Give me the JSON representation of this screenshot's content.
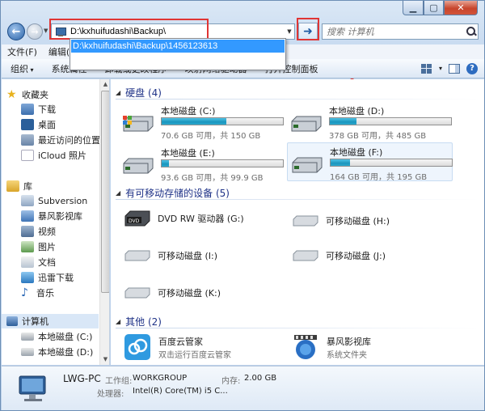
{
  "address": {
    "value": "D:\\kxhuifudashi\\Backup\\",
    "suggestion": "D:\\kxhuifudashi\\Backup\\1456123613"
  },
  "search": {
    "placeholder": "搜索 计算机"
  },
  "menu": {
    "file": "文件(F)",
    "edit": "编辑(E)"
  },
  "toolbar": {
    "organize": "组织",
    "system_properties": "系统属性",
    "uninstall": "卸载或更改程序",
    "map_drive": "映射网络驱动器",
    "control_panel": "打开控制面板"
  },
  "nav": {
    "favorites": "收藏夹",
    "downloads": "下载",
    "desktop": "桌面",
    "recent": "最近访问的位置",
    "icloud": "iCloud 照片",
    "libraries": "库",
    "subversion": "Subversion",
    "baofeng": "暴风影视库",
    "video": "视频",
    "pictures": "图片",
    "documents": "文档",
    "thunder": "迅雷下载",
    "music": "音乐",
    "computer": "计算机",
    "disk_c": "本地磁盘 (C:)",
    "disk_d": "本地磁盘 (D:)"
  },
  "groups": {
    "hdd": "硬盘 (4)",
    "removable": "有可移动存储的设备 (5)",
    "other": "其他 (2)"
  },
  "drives": [
    {
      "name": "本地磁盘 (C:)",
      "info": "70.6 GB 可用，共 150 GB",
      "used_fraction": 0.53
    },
    {
      "name": "本地磁盘 (D:)",
      "info": "378 GB 可用，共 485 GB",
      "used_fraction": 0.22
    },
    {
      "name": "本地磁盘 (E:)",
      "info": "93.6 GB 可用，共 99.9 GB",
      "used_fraction": 0.06
    },
    {
      "name": "本地磁盘 (F:)",
      "info": "164 GB 可用，共 195 GB",
      "used_fraction": 0.16
    }
  ],
  "devices": [
    {
      "name": "DVD RW 驱动器 (G:)"
    },
    {
      "name": "可移动磁盘 (H:)"
    },
    {
      "name": "可移动磁盘 (I:)"
    },
    {
      "name": "可移动磁盘 (J:)"
    },
    {
      "name": "可移动磁盘 (K:)"
    }
  ],
  "others": [
    {
      "name": "百度云管家",
      "desc": "双击运行百度云管家"
    },
    {
      "name": "暴风影视库",
      "desc": "系统文件夹"
    }
  ],
  "details": {
    "pc_name": "LWG-PC",
    "workgroup_label": "工作组:",
    "workgroup": "WORKGROUP",
    "memory_label": "内存:",
    "memory": "2.00 GB",
    "cpu_label": "处理器:",
    "cpu": "Intel(R) Core(TM) i5 C..."
  },
  "colors": {
    "highlight": "#e03534",
    "selection": "#3399ff",
    "bar_fill": "#26a6d1"
  }
}
